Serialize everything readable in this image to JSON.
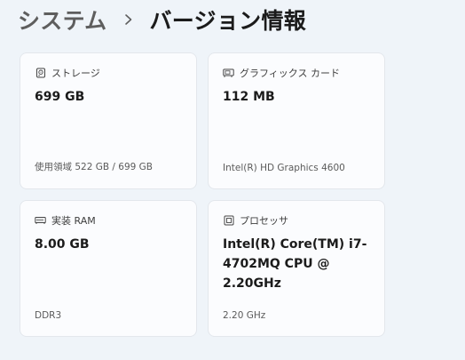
{
  "breadcrumb": {
    "parent": "システム",
    "separator_icon": "chevron-right-icon",
    "current": "バージョン情報"
  },
  "cards": {
    "storage": {
      "icon": "hard-drive-icon",
      "title": "ストレージ",
      "value": "699 GB",
      "sub": "使用領域 522 GB / 699 GB"
    },
    "graphics": {
      "icon": "graphics-card-icon",
      "title": "グラフィックス カード",
      "value": "112 MB",
      "sub": "Intel(R) HD Graphics 4600"
    },
    "ram": {
      "icon": "memory-icon",
      "title": "実装 RAM",
      "value": "8.00 GB",
      "sub": "DDR3"
    },
    "processor": {
      "icon": "processor-icon",
      "title": "プロセッサ",
      "value": "Intel(R) Core(TM) i7-4702MQ CPU @ 2.20GHz",
      "sub": "2.20 GHz"
    }
  },
  "colors": {
    "background": "#eff4f9",
    "card": "#fbfcfe",
    "card_border": "#e3e7ec",
    "text_primary": "#1b1b1b",
    "text_secondary": "#5b5b5b"
  }
}
